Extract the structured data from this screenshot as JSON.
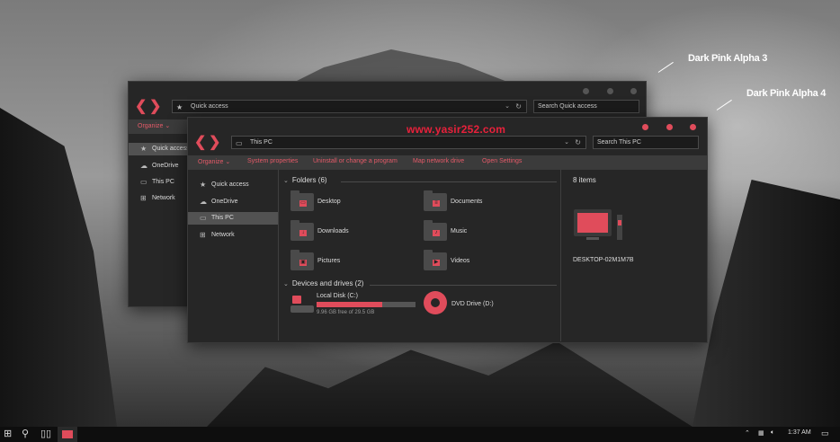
{
  "colors": {
    "accent": "#e04c5b",
    "window_bg": "#262626",
    "ribbon_bg": "#3b3b3b",
    "taskbar_bg": "#0e0e0e"
  },
  "annotations": {
    "alpha3": "Dark Pink Alpha 3",
    "alpha4": "Dark Pink Alpha 4"
  },
  "watermark": "www.yasir252.com",
  "back_window": {
    "address": "Quick access",
    "search_placeholder": "Search Quick access",
    "ribbon_organize": "Organize",
    "nav": [
      "Quick access",
      "OneDrive",
      "This PC",
      "Network"
    ]
  },
  "front_window": {
    "address": "This PC",
    "search_placeholder": "Search This PC",
    "ribbon": [
      "Organize",
      "System properties",
      "Uninstall or change a program",
      "Map network drive",
      "Open Settings"
    ],
    "nav": [
      "Quick access",
      "OneDrive",
      "This PC",
      "Network"
    ],
    "folders_header": "Folders (6)",
    "folders": [
      "Desktop",
      "Documents",
      "Downloads",
      "Music",
      "Pictures",
      "Videos"
    ],
    "devices_header": "Devices and drives (2)",
    "local_disk": {
      "name": "Local Disk (C:)",
      "free": "9.96 GB free of 29.5 GB",
      "used_fraction": 0.66
    },
    "dvd": "DVD Drive (D:)",
    "items_count": "8 items",
    "computer_name": "DESKTOP-02M1M7B"
  },
  "taskbar": {
    "time": "1:37 AM"
  },
  "icons": [
    "windows-icon",
    "search-icon",
    "task-view-icon",
    "file-explorer-icon",
    "chevron-up-icon",
    "network-icon",
    "volume-icon",
    "notification-icon"
  ]
}
